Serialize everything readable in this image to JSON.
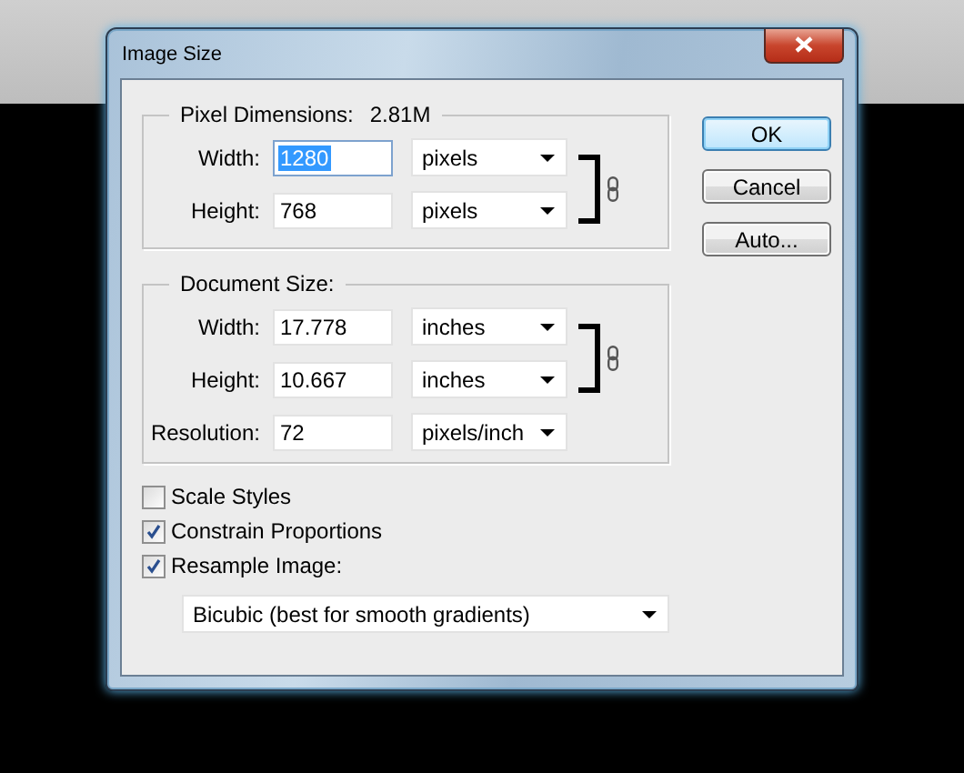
{
  "window": {
    "title": "Image Size"
  },
  "pixel_dimensions": {
    "label": "Pixel Dimensions:",
    "value": "2.81M",
    "linked": true,
    "rows": [
      {
        "label": "Width:",
        "value": "1280",
        "highlighted": true,
        "unit": "pixels"
      },
      {
        "label": "Height:",
        "value": "768",
        "highlighted": false,
        "unit": "pixels"
      }
    ]
  },
  "document_size": {
    "label": "Document Size:",
    "linked": true,
    "rows": [
      {
        "label": "Width:",
        "value": "17.778",
        "highlighted": false,
        "unit": "inches"
      },
      {
        "label": "Height:",
        "value": "10.667",
        "highlighted": false,
        "unit": "inches"
      },
      {
        "label": "Resolution:",
        "value": "72",
        "highlighted": false,
        "unit": "pixels/inch"
      }
    ]
  },
  "buttons": [
    {
      "label": "OK",
      "default": true
    },
    {
      "label": "Cancel",
      "default": false
    },
    {
      "label": "Auto...",
      "default": false
    }
  ],
  "options": [
    {
      "label": "Scale Styles",
      "checked": false
    },
    {
      "label": "Constrain Proportions",
      "checked": true
    },
    {
      "label": "Resample Image:",
      "checked": true
    }
  ],
  "resample_method": "Bicubic (best for smooth gradients)"
}
